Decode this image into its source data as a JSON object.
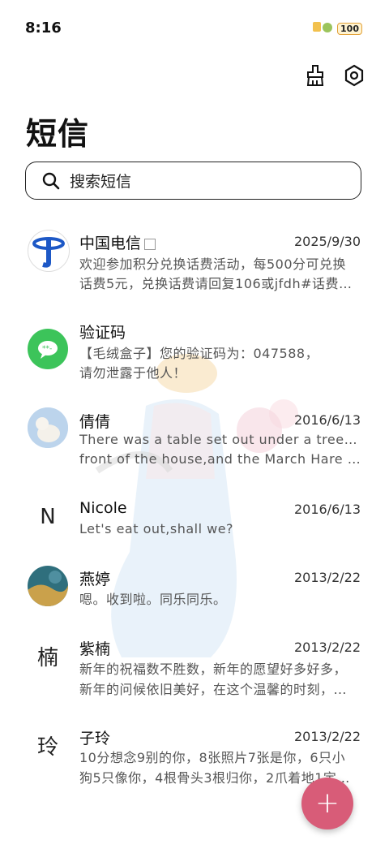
{
  "status": {
    "time": "8:16",
    "battery": "100"
  },
  "header": {
    "title": "短信"
  },
  "search": {
    "placeholder": "搜索短信"
  },
  "messages": [
    {
      "name": "中国电信",
      "date": "2025/9/30",
      "line1": "欢迎参加积分兑换话费活动，每500分可兑换",
      "line2": "话费5元，兑换话费请回复106或jfdh#话费…",
      "avatar": "telecom-logo"
    },
    {
      "name": "验证码",
      "date": "",
      "line1": "【毛绒盒子】您的验证码为：047588，",
      "line2": "请勿泄露于他人！",
      "avatar": "message-bubble-icon"
    },
    {
      "name": "倩倩",
      "date": "2016/6/13",
      "line1": "There was a table set out under a tree in",
      "line2": "front of the house,and the March Hare an…",
      "avatar": "polar-bear-photo"
    },
    {
      "name": "Nicole",
      "date": "2016/6/13",
      "line1": "Let's eat out,shall we?",
      "line2": "",
      "avatar_letter": "N"
    },
    {
      "name": "燕婷",
      "date": "2013/2/22",
      "line1": "嗯。收到啦。同乐同乐。",
      "line2": "",
      "avatar": "landscape-photo"
    },
    {
      "name": "紫楠",
      "date": "2013/2/22",
      "line1": "新年的祝福数不胜数，新年的愿望好多好多，",
      "line2": "新年的问候依旧美好，在这个温馨的时刻，…",
      "avatar_letter": "楠"
    },
    {
      "name": "子玲",
      "date": "2013/2/22",
      "line1": "10分想念9别的你，8张照片7张是你，6只小",
      "line2": "狗5只像你，4根骨头3根归你，2爪着地1定…",
      "avatar_letter": "玲"
    }
  ],
  "fab": {
    "label": "+"
  },
  "colors": {
    "accent": "#d85c78",
    "wechat_green": "#3cc45a",
    "telecom_blue": "#1d58c6"
  }
}
